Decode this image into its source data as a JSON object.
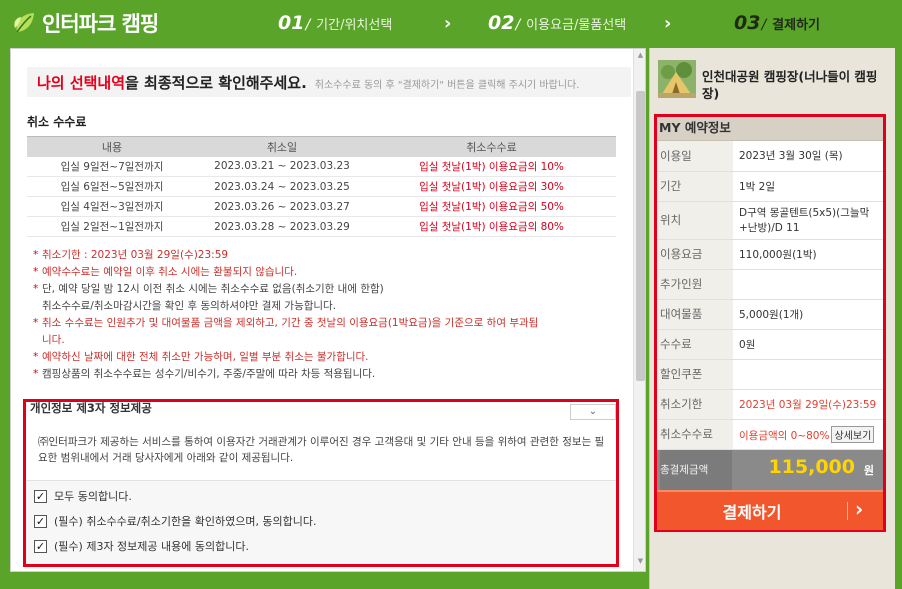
{
  "header": {
    "logo_text": "인터파크 캠핑",
    "steps": [
      {
        "num": "01",
        "label": "기간/위치선택"
      },
      {
        "num": "02",
        "label": "이용요금/물품선택"
      },
      {
        "num": "03",
        "label": "결제하기"
      }
    ],
    "arrow": "›"
  },
  "notice": {
    "emphasis": "나의 선택내역",
    "rest": "을 최종적으로 확인해주세요.",
    "small": "취소수수료 동의 후 \"결제하기\" 버튼을 클릭해 주시기 바랍니다."
  },
  "cancel_fee": {
    "title": "취소 수수료",
    "headers": [
      "내용",
      "취소일",
      "취소수수료"
    ],
    "rows": [
      {
        "content": "입실 9일전~7일전까지",
        "date": "2023.03.21 ~ 2023.03.23",
        "fee": "입실 첫날(1박) 이용요금의 10%"
      },
      {
        "content": "입실 6일전~5일전까지",
        "date": "2023.03.24 ~ 2023.03.25",
        "fee": "입실 첫날(1박) 이용요금의 30%"
      },
      {
        "content": "입실 4일전~3일전까지",
        "date": "2023.03.26 ~ 2023.03.27",
        "fee": "입실 첫날(1박) 이용요금의 50%"
      },
      {
        "content": "입실 2일전~1일전까지",
        "date": "2023.03.28 ~ 2023.03.29",
        "fee": "입실 첫날(1박) 이용요금의 80%"
      }
    ],
    "notes": [
      "취소기한 : 2023년 03월 29일(수)23:59",
      "예약수수료는 예약일 이후 취소 시에는 환불되지 않습니다.",
      "단, 예약 당일 밤 12시 이전 취소 시에는 취소수수료 없음(취소기한 내에 한함)",
      "취소수수료/취소마감시간을 확인 후 동의하셔야만 결제 가능합니다.",
      "취소 수수료는 인원추가 및 대여물품 금액을 제외하고, 기간 중 첫날의 이용요금(1박요금)을 기준으로 하여 부과됩",
      "니다.",
      "예약하신 날짜에 대한 전체 취소만 가능하며, 일별 부분 취소는 불가합니다.",
      "캠핑상품의 취소수수료는 성수기/비수기, 주중/주말에 따라 차등 적용됩니다."
    ]
  },
  "consent": {
    "title": "개인정보 제3자 정보제공",
    "toggle_icon": "chevron-down",
    "text": "㈜인터파크가 제공하는 서비스를 통하여 이용자간 거래관계가 이루어진 경우 고객응대 및 기타 안내 등을 위하여 관련한 정보는 필요한 범위내에서 거래 당사자에게 아래와 같이 제공됩니다.",
    "checks": [
      {
        "label": "모두 동의합니다.",
        "checked": true
      },
      {
        "label": "(필수) 취소수수료/취소기한을 확인하였으며, 동의합니다.",
        "checked": true
      },
      {
        "label": "(필수) 제3자 정보제공 내용에 동의합니다.",
        "checked": true
      }
    ]
  },
  "sidebar": {
    "camp_name": "인천대공원 캠핑장(너나들이 캠핑장)",
    "my_title": "MY 예약정보",
    "rows": [
      {
        "key": "이용일",
        "value": "2023년 3월 30일 (목)"
      },
      {
        "key": "기간",
        "value": "1박 2일"
      },
      {
        "key": "위치",
        "value": "D구역 몽골텐트(5x5)(그늘막+난방)/D 11"
      },
      {
        "key": "이용요금",
        "value": "110,000원(1박)"
      },
      {
        "key": "추가인원",
        "value": ""
      },
      {
        "key": "대여물품",
        "value": "5,000원(1개)"
      },
      {
        "key": "수수료",
        "value": "0원"
      },
      {
        "key": "할인쿠폰",
        "value": ""
      },
      {
        "key": "취소기한",
        "value": "2023년 03월 29일(수)23:59"
      },
      {
        "key": "취소수수료",
        "value": "이용금액의 0~80%"
      }
    ],
    "detail_btn": "상세보기",
    "total_label": "총결제금액",
    "total_amount": "115,000",
    "total_unit": "원",
    "pay_button": "결제하기",
    "colors": {
      "accent": "#e0001c",
      "pay": "#f1562c",
      "header": "#5aa42a",
      "amount": "#ffd400"
    }
  }
}
